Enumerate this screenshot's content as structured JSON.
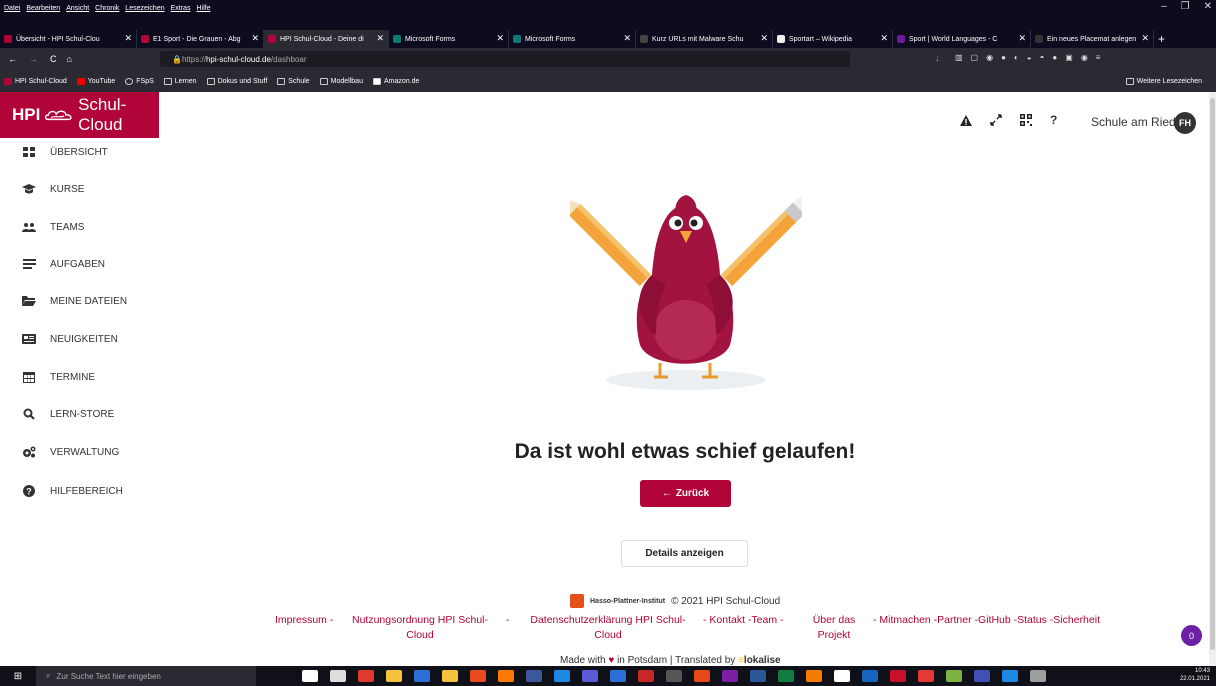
{
  "browser": {
    "menu": [
      "Datei",
      "Bearbeiten",
      "Ansicht",
      "Chronik",
      "Lesezeichen",
      "Extras",
      "Hilfe"
    ],
    "tabs": [
      {
        "label": "Übersicht - HPI Schul-Clou",
        "color": "#b10438"
      },
      {
        "label": "E1 Sport - Die Grauen - Abg",
        "color": "#b10438"
      },
      {
        "label": "HPI Schul-Cloud - Deine di",
        "color": "#b10438"
      },
      {
        "label": "Microsoft Forms",
        "color": "#0b7a75"
      },
      {
        "label": "Microsoft Forms",
        "color": "#0b7a75"
      },
      {
        "label": "Kurz URLs mit Malware Schu",
        "color": "#444"
      },
      {
        "label": "Sportart – Wikipedia",
        "color": "#eee"
      },
      {
        "label": "Sport | World Languages - C",
        "color": "#6a1b9a"
      },
      {
        "label": "Ein neues Placemat anlegen",
        "color": "#333"
      }
    ],
    "url_prefix": "https://",
    "url_host": "hpi-schul-cloud.de",
    "url_path": "/dashboar",
    "bookmarks": [
      "HPI Schul-Cloud",
      "YouTube",
      "FSpS",
      "Lernen",
      "Dokus und Stuff",
      "Schule",
      "Modellbau",
      "Amazon.de"
    ],
    "other_bookmarks": "Weitere Lesezeichen"
  },
  "sidebar": {
    "logo_hpi": "HPI",
    "logo_text": "Schul-Cloud",
    "items": [
      {
        "label": "ÜBERSICHT",
        "icon": "dashboard-icon"
      },
      {
        "label": "KURSE",
        "icon": "graduation-cap-icon"
      },
      {
        "label": "TEAMS",
        "icon": "users-icon"
      },
      {
        "label": "AUFGABEN",
        "icon": "tasks-icon"
      },
      {
        "label": "MEINE DATEIEN",
        "icon": "folder-icon"
      },
      {
        "label": "NEUIGKEITEN",
        "icon": "newspaper-icon"
      },
      {
        "label": "TERMINE",
        "icon": "calendar-icon"
      },
      {
        "label": "LERN-STORE",
        "icon": "search-icon"
      },
      {
        "label": "VERWALTUNG",
        "icon": "cogs-icon"
      },
      {
        "label": "HILFEBEREICH",
        "icon": "help-icon"
      }
    ]
  },
  "header": {
    "school": "Schule am Ried",
    "avatar": "FH",
    "help": "?"
  },
  "error": {
    "title": "Da ist wohl etwas schief gelaufen!",
    "back_label": "Zurück",
    "details_label": "Details anzeigen"
  },
  "footer": {
    "institute": "Hasso-Plattner-Institut",
    "copyright": "© 2021 HPI Schul-Cloud",
    "links": {
      "impressum": "Impressum -",
      "nutzung": "Nutzungsordnung HPI Schul-Cloud",
      "sep1": "-",
      "datenschutz": "Datenschutzerklärung HPI Schul-Cloud",
      "kontakt": "- Kontakt -Team -",
      "projekt": "Über das Projekt",
      "rest": "- Mitmachen -Partner -GitHub -Status -Sicherheit"
    },
    "made_with_pre": "Made with",
    "made_with_post": "in Potsdam | Translated by",
    "translator": "lokalise"
  },
  "notifications": "0",
  "taskbar": {
    "search_placeholder": "Zur Suche Text hier eingeben",
    "time": "10:43",
    "date": "22.01.2021"
  },
  "colors": {
    "brand": "#b10438"
  }
}
